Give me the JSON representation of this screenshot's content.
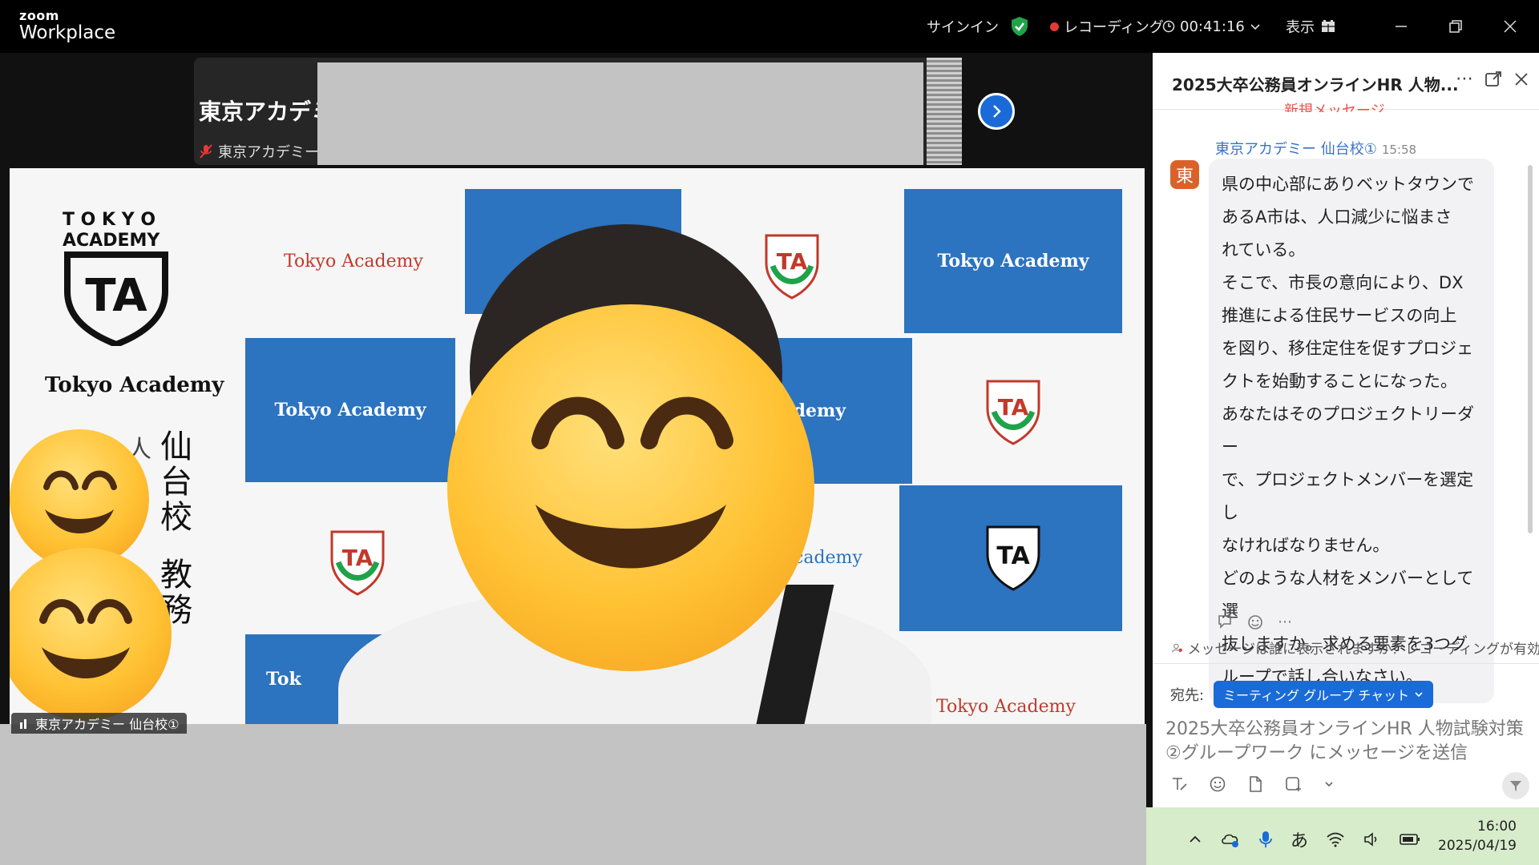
{
  "app": {
    "logo_line1": "zoom",
    "logo_line2": "Workplace"
  },
  "topbar": {
    "signin": "サインイン",
    "recording": "レコーディング",
    "timer": "00:41:16",
    "view": "表示"
  },
  "strip": {
    "participant_name": "東京アカデミ",
    "participant_sub": "東京アカデミーI"
  },
  "video": {
    "brand": "Tokyo Academy",
    "logo_word1": "T O K Y O",
    "logo_word2": "ACADEMY",
    "logo_mark": "TA",
    "vertical_campus": "仙台校",
    "vertical_role": "教務",
    "vertical_partial": "人",
    "panel_partial_1": "cademy",
    "panel_partial_2": "cademy",
    "panel_partial_3": "Tok",
    "name_label": "東京アカデミー 仙台校①"
  },
  "chat": {
    "title": "2025大卒公務員オンラインHR 人物...",
    "cut_text": "新規メッセージ",
    "sender": "東京アカデミー 仙台校①",
    "time": "15:58",
    "avatar": "東",
    "message_lines": [
      "県の中心部にありベットタウンで",
      "あるA市は、人口減少に悩まさ",
      "れている。",
      "そこで、市長の意向により、DX",
      "推進による住民サービスの向上",
      "を図り、移住定住を促すプロジェ",
      "クトを始動することになった。",
      "あなたはそのプロジェクトリーダー",
      "で、プロジェクトメンバーを選定し",
      "なければなりません。",
      "どのような人材をメンバーとして選",
      "抜しますか。求める要素を3つグ",
      "ループで話し合いなさい。"
    ],
    "visibility_info": "メッセージは誰に表示されますか？レコーディングが有効",
    "to_label": "宛先:",
    "to_target": "ミーティング グループ チャット",
    "compose_placeholder": "2025大卒公務員オンラインHR 人物試験対策②グループワーク にメッセージを送信"
  },
  "taskbar": {
    "ime": "あ",
    "time": "16:00",
    "date": "2025/04/19"
  },
  "colors": {
    "accent": "#1a6bd8",
    "recording_dot": "#e53935",
    "shield_green": "#1fa34a",
    "panel_blue": "#2c73c0",
    "taskbar": "#d6ecca"
  }
}
